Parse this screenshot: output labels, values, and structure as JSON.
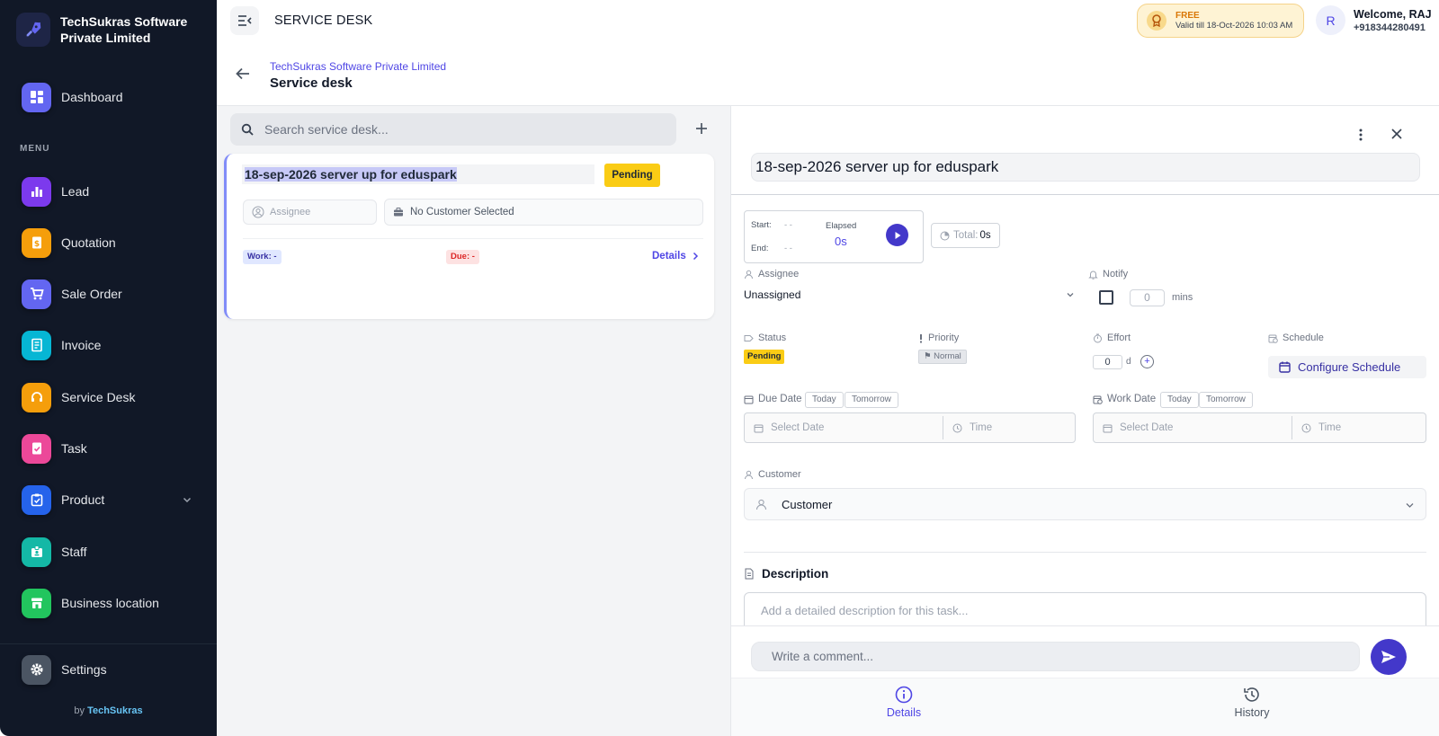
{
  "brand": {
    "name": "TechSukras Software Private Limited"
  },
  "sidebar": {
    "dashboard_label": "Dashboard",
    "menu_caption": "MENU",
    "items": [
      {
        "label": "Lead",
        "color": "#7c3aed"
      },
      {
        "label": "Quotation",
        "color": "#f59e0b"
      },
      {
        "label": "Sale Order",
        "color": "#6366f1"
      },
      {
        "label": "Invoice",
        "color": "#06b6d4"
      },
      {
        "label": "Service Desk",
        "color": "#f59e0b"
      },
      {
        "label": "Task",
        "color": "#ec4899"
      },
      {
        "label": "Product",
        "color": "#2563eb"
      },
      {
        "label": "Staff",
        "color": "#14b8a6"
      },
      {
        "label": "Business location",
        "color": "#22c55e"
      }
    ],
    "settings_label": "Settings",
    "by_prefix": "by",
    "by_brand": "TechSukras"
  },
  "topbar": {
    "title": "SERVICE DESK",
    "plan_label": "FREE",
    "plan_validity": "Valid till 18-Oct-2026 10:03 AM",
    "avatar_letter": "R",
    "welcome": "Welcome, RAJ",
    "phone": "+918344280491"
  },
  "breadcrumb": {
    "company": "TechSukras Software Private Limited",
    "title": "Service desk"
  },
  "list": {
    "search_placeholder": "Search service desk...",
    "tickets": [
      {
        "title": "18-sep-2026 server up for eduspark",
        "status": "Pending",
        "assignee_placeholder": "Assignee",
        "customer": "No Customer Selected",
        "work": "Work: -",
        "due": "Due: -",
        "details_label": "Details"
      }
    ]
  },
  "detail": {
    "title": "18-sep-2026 server up for eduspark",
    "timer": {
      "start_label": "Start:",
      "end_label": "End:",
      "start_value": "-   -",
      "end_value": "-   -",
      "elapsed_label": "Elapsed",
      "elapsed_value": "0s",
      "total_label": "Total:",
      "total_value": "0s"
    },
    "assignee_label": "Assignee",
    "assignee_value": "Unassigned",
    "notify_label": "Notify",
    "notify_value": "0",
    "notify_unit": "mins",
    "status_label": "Status",
    "status_value": "Pending",
    "priority_label": "Priority",
    "priority_value": "⚑ Normal",
    "effort_label": "Effort",
    "effort_value": "0",
    "effort_unit": "d",
    "schedule_label": "Schedule",
    "schedule_button": "Configure Schedule",
    "due_date_label": "Due Date",
    "work_date_label": "Work Date",
    "today_label": "Today",
    "tomorrow_label": "Tomorrow",
    "select_date_placeholder": "Select Date",
    "time_placeholder": "Time",
    "customer_label": "Customer",
    "customer_value": "Customer",
    "description_heading": "Description",
    "description_placeholder": "Add a detailed description for this task...",
    "comment_placeholder": "Write a comment...",
    "tabs": [
      {
        "label": "Details",
        "active": true
      },
      {
        "label": "History",
        "active": false
      }
    ]
  },
  "colors": {
    "accent": "#4f46e5",
    "sidebar_bg": "#111827",
    "pending": "#facc15"
  }
}
